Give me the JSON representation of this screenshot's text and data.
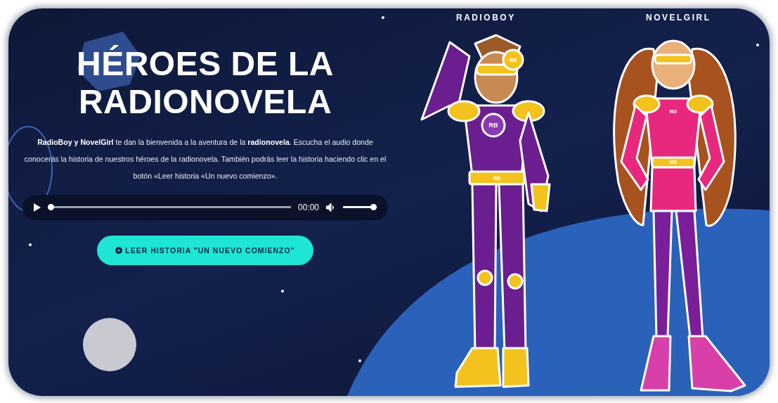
{
  "hero": {
    "title": "HÉROES DE LA RADIONOVELA",
    "intro": "**RadioBoy y NovelGirl** te dan la bienvenida a la aventura de la **radionovela**. Escucha el audio donde conocerás la historia de nuestros héroes de la radionovela. También podrás leer la historia haciendo clic en el botón «Leer historia «Un nuevo comienzo».",
    "player": {
      "time": "00:00",
      "progress": {
        "level": 0
      },
      "volume": {
        "level": 1
      }
    },
    "button": {
      "label": "LEER HISTORIA \"UN NUEVO COMIENZO\""
    }
  },
  "characters": [
    {
      "name": "RADIOBOY",
      "kind": "boy",
      "emblems": [
        "RB",
        "RB",
        "RB"
      ]
    },
    {
      "name": "NOVELGIRL",
      "kind": "girl",
      "emblems": [
        "NG",
        "NG"
      ]
    }
  ]
}
